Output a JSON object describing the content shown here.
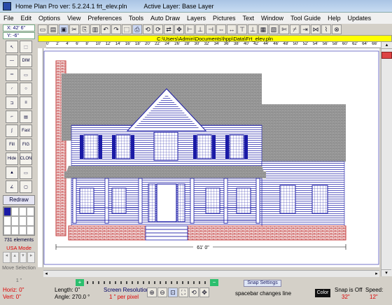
{
  "window": {
    "title": "Home Plan Pro ver: 5.2.24.1    frt_elev.pln",
    "active_layer": "Active Layer: Base Layer"
  },
  "menu": [
    "File",
    "Edit",
    "Options",
    "View",
    "Preferences",
    "Tools",
    "Auto Draw",
    "Layers",
    "Pictures",
    "Text",
    "Window",
    "Tool Guide",
    "Help",
    "Updates"
  ],
  "coords": {
    "x": "X: 42' 6\"",
    "y": "Y: -6\""
  },
  "path": "C:\\Users\\Admin\\Documents\\hpp\\Data\\Frt_elev.pln",
  "left_panel": {
    "redraw": "Redraw",
    "elements": "731 elements",
    "mode": "USA Mode",
    "move_selection": "Move Selection",
    "step": "1 \""
  },
  "ruler_marks": [
    "0'",
    "2'",
    "4'",
    "6'",
    "8'",
    "10'",
    "12'",
    "14'",
    "16'",
    "18'",
    "20'",
    "22'",
    "24'",
    "26'",
    "28'",
    "30'",
    "32'",
    "34'",
    "36'",
    "38'",
    "40'",
    "42'",
    "44'",
    "46'",
    "48'",
    "50'",
    "52'",
    "54'",
    "56'",
    "58'",
    "60'",
    "62'",
    "64'",
    "66'"
  ],
  "dimension": "61' 0\"",
  "snap_settings": "Snap Settings",
  "status": {
    "horiz": "Horiz: 0\"",
    "vert": "Vert: 0\"",
    "length": "Length: 0\"",
    "angle": "Angle: 270.0 °",
    "screen_res_label": "Screen Resolution",
    "screen_res_value": "1 \" per pixel",
    "hint": "spacebar changes line",
    "color": "Color",
    "snap_label": "Snap is Off",
    "snap_value": "32\"",
    "speed_label": "Speed:",
    "speed_value": "12\""
  },
  "colors": {
    "accent_red": "#cc0000",
    "path_bg": "#ffff00",
    "house_blue": "#1a1aa6",
    "brick": "#c43a3a",
    "roof": "#8c8c8c"
  }
}
